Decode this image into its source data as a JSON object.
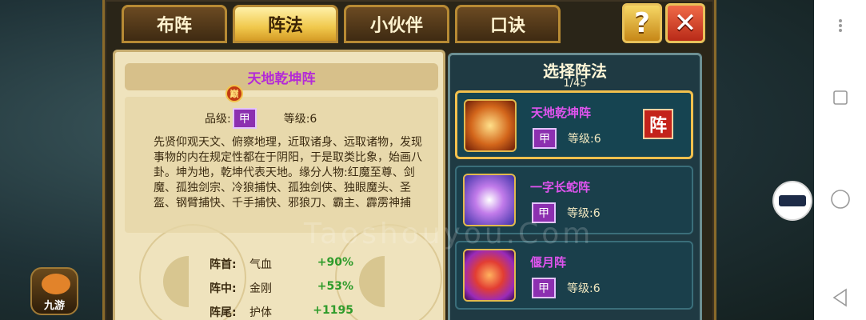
{
  "tabs": [
    {
      "label": "布阵",
      "active": false
    },
    {
      "label": "阵法",
      "active": true
    },
    {
      "label": "小伙伴",
      "active": false
    },
    {
      "label": "口诀",
      "active": false
    }
  ],
  "header_buttons": {
    "help": "?",
    "close": "✕"
  },
  "detail": {
    "name": "天地乾坤阵",
    "grade_label": "品级:",
    "grade_value": "甲",
    "level_label": "等级:6",
    "description": "先贤仰观天文、俯察地理，近取诸身、远取诸物，发现事物的内在规定性都在于阴阳，于是取类比象，始画八卦。坤为地，乾坤代表天地。缘分人物:红魔至尊、剑魔、孤独剑宗、冷狼捕快、孤独剑侠、独眼魔头、圣盔、钢臂捕快、千手捕快、邪狼刀、霸主、霹雳神捕",
    "stats": [
      {
        "position": "阵首:",
        "attr": "气血",
        "value": "+90%"
      },
      {
        "position": "阵中:",
        "attr": "金刚",
        "value": "+53%"
      },
      {
        "position": "阵尾:",
        "attr": "护体",
        "value": "+1195"
      }
    ]
  },
  "selector": {
    "title": "选择阵法",
    "count": "1/45",
    "peak_badge": "巅",
    "items": [
      {
        "name": "天地乾坤阵",
        "grade": "甲",
        "level": "等级:6",
        "selected": true,
        "seal": "阵"
      },
      {
        "name": "一字长蛇阵",
        "grade": "甲",
        "level": "等级:6",
        "selected": false
      },
      {
        "name": "偃月阵",
        "grade": "甲",
        "level": "等级:6",
        "selected": false
      }
    ]
  },
  "logo_text": "九游",
  "watermark": "Taoshouyou.Com",
  "colors": {
    "accent_gold": "#f0c84c",
    "purple_name": "#e054ef",
    "stat_green": "#2e9b2a"
  }
}
